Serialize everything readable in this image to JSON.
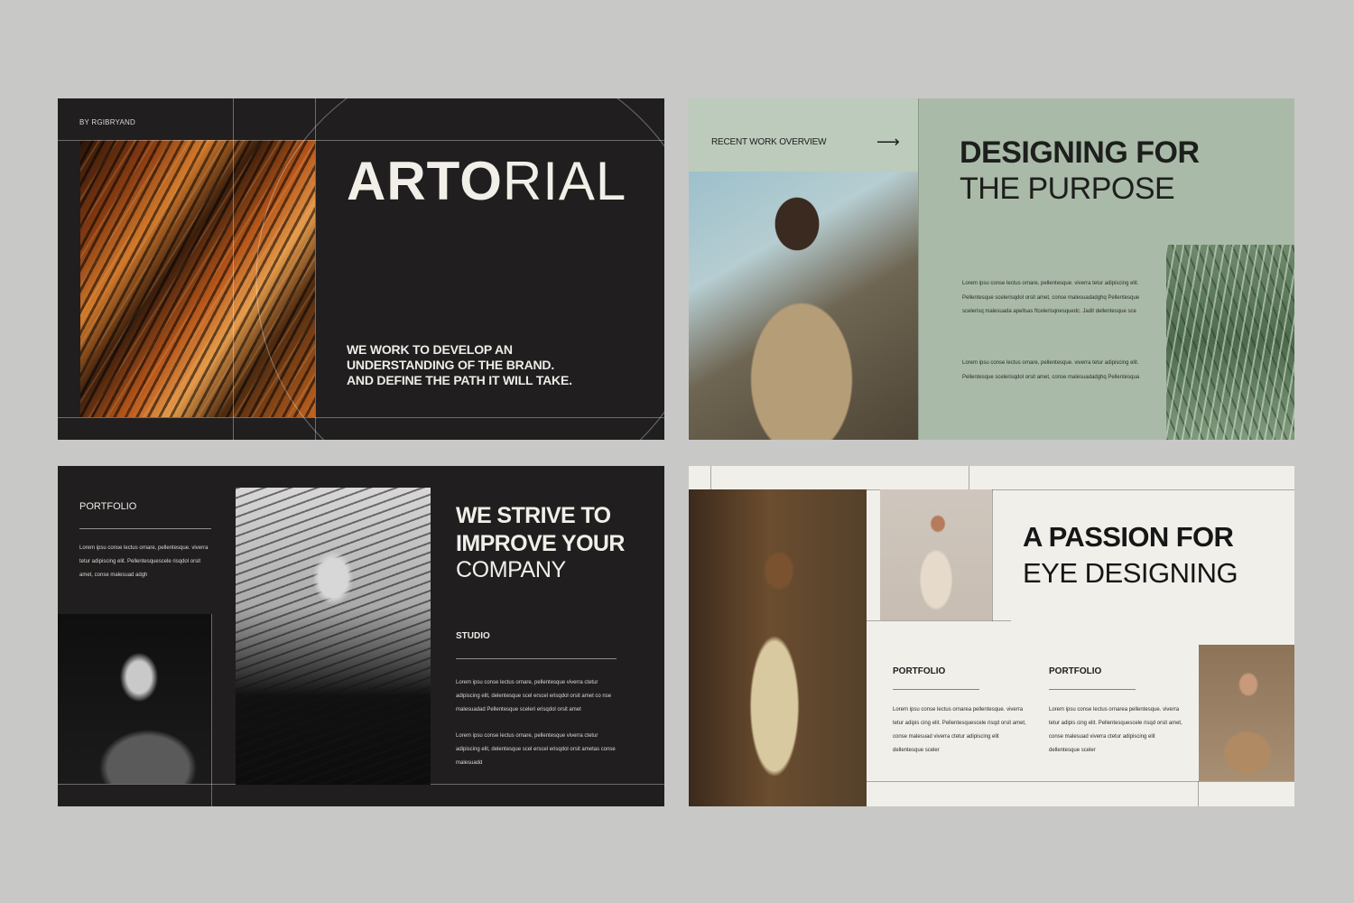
{
  "slide1": {
    "byline": "BY RGIBRYAND",
    "title_bold": "ARTO",
    "title_light": "RIAL",
    "tagline_lines": [
      "WE WORK TO DEVELOP AN",
      "UNDERSTANDING OF THE BRAND.",
      "AND DEFINE THE PATH IT WILL TAKE."
    ]
  },
  "slide2": {
    "header_label": "RECENT WORK OVERVIEW",
    "arrow": "⟶",
    "heading_bold": "DESIGNING FOR",
    "heading_light": "THE PURPOSE",
    "para1": "Lorem ipsu conse lectus ornare, pellentesque. viverra tetur adipiscing elit. Pellentesque scelerisqdol orsit amet, conse malesuadadghq Pellentesque scelerisq malesuada apellsas ftcelerisqnesquedc. Jadit dellentesque sce",
    "para2": "Lorem ipsu conse lectus ornare, pellentesque. viverra tetur adipiscing elit. Pellentesque scelerisqdol orsit amet, conse malesuadadghq Pellentesqua"
  },
  "slide3": {
    "portfolio_label": "PORTFOLIO",
    "portfolio_text": "Lorem ipsu conse lectus ornare, pellentesque. viverra tetur adipiscing elit. Pellentesquescele risqdol orsit amet, conse malesuad adgh",
    "heading_bold_lines": [
      "WE STRIVE TO",
      "IMPROVE YOUR"
    ],
    "heading_light": "COMPANY",
    "studio_label": "STUDIO",
    "studio_text1": "Lorem ipsu conse lectus ornare, pellentesque viverra ctetur adipiscing elit, delentesque scel erscel erisqdol orsit amet co nse malesuadad Pellentesque sceleri erisqdol orsit amet",
    "studio_text2": "Lorem ipsu conse lectus ornare, pellentesque viverra ctetur adipiscing elit, delentesque scel erscel erisqdol orsit ametas conse malesuadd"
  },
  "slide4": {
    "heading_bold": "A PASSION FOR",
    "heading_light": "EYE DESIGNING",
    "col1": {
      "label": "PORTFOLIO",
      "text": "Lorem ipsu conse lectus ornarea pellentesque. viverra tetur adipis cing elit. Pellentesquescele risqd orsit amet, conse malesuad viverra ctetur adipiscing elit dellentesque sceler"
    },
    "col2": {
      "label": "PORTFOLIO",
      "text": "Lorem ipsu conse lectus ornarea pellentesque. viverra tetur adipis cing elit. Pellentesquescele risqd orsit amet, conse malesuad viverra ctetur adipiscing elit dellentesque sceler"
    }
  },
  "colors": {
    "background": "#c8c8c7",
    "dark_slide": "#201e1f",
    "sage_slide": "#aabaa9",
    "cream_slide": "#f1efea"
  }
}
